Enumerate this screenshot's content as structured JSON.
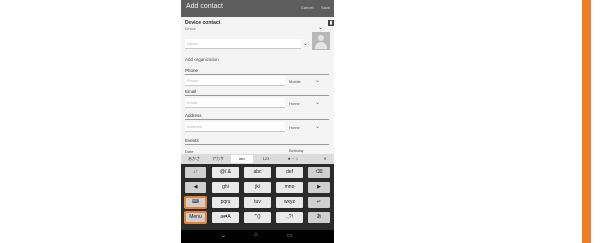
{
  "app": {
    "title": "Add contact",
    "cancel": "Cancel",
    "save": "Save"
  },
  "account": {
    "title": "Device contact",
    "subtitle": "Device"
  },
  "fields": {
    "name_placeholder": "Name",
    "add_org": "Add organization",
    "phone_label": "Phone",
    "phone_placeholder": "Phone",
    "phone_type": "Mobile",
    "email_label": "Email",
    "email_placeholder": "Email",
    "email_type": "Home",
    "address_label": "Address",
    "address_placeholder": "Address",
    "address_type": "Home",
    "events_label": "Events",
    "date_label": "Date",
    "date_value": "Birthday"
  },
  "ime_tabs": [
    "あかさ",
    "アカサ",
    "abc",
    "123",
    "★・☆",
    "✕"
  ],
  "keyboard": {
    "rows": [
      [
        "↓↑",
        "@/.&",
        "abc",
        "def",
        "⌫"
      ],
      [
        "◀",
        "ghi",
        "jkl",
        "mno",
        "▶"
      ],
      [
        "⌨",
        "pqrs",
        "tuv",
        "wxyz",
        "↵"
      ],
      [
        "Menu",
        "a⇄A",
        "'\"()",
        ".,?!",
        "あ"
      ]
    ]
  },
  "nav": {
    "back": "⌄",
    "home": "⌂",
    "recent": "▭"
  },
  "colors": {
    "accent": "#f07c24",
    "highlight": "#e8822f"
  }
}
